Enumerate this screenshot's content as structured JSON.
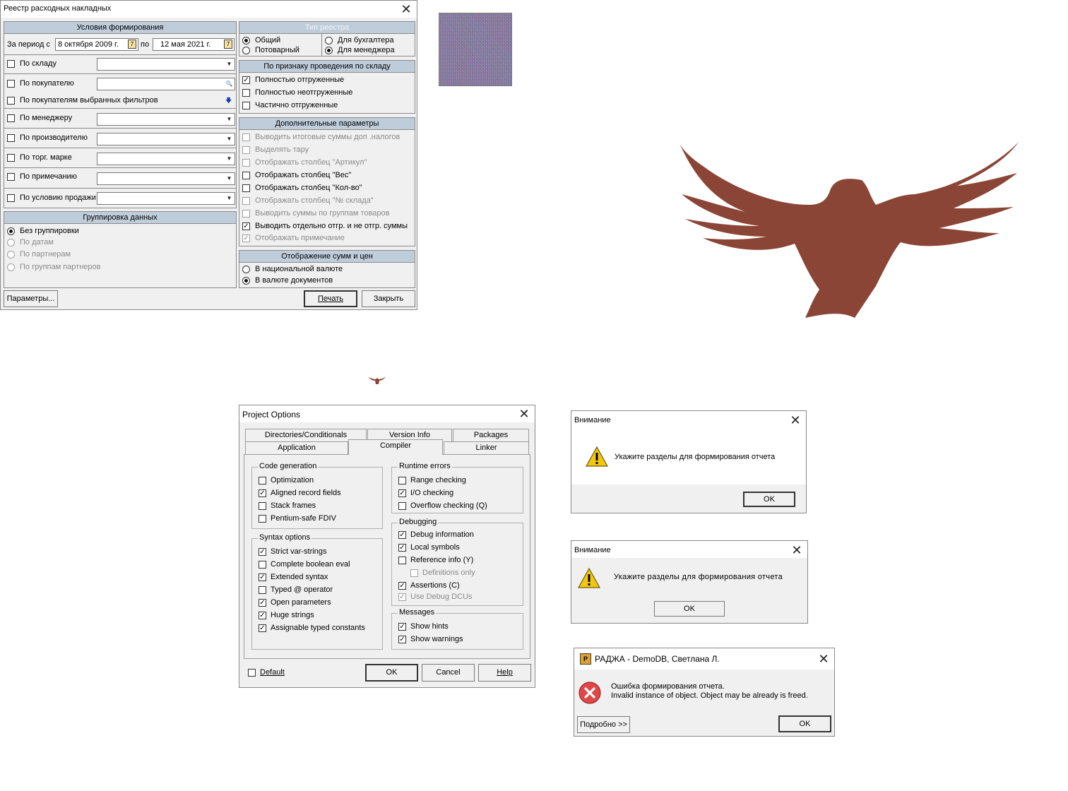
{
  "reestr": {
    "title": "Реестр расходных накладных",
    "conditions": {
      "header": "Условия формирования",
      "period_from_label": "За период с",
      "date_from": "8 октября 2009 г.",
      "to_label": "по",
      "date_to": "12 мая 2021 г.",
      "filters": [
        {
          "label": "По складу",
          "checked": false
        },
        {
          "label": "По покупателю",
          "checked": false
        },
        {
          "label": "По покупателям выбранных фильтров",
          "checked": false
        },
        {
          "label": "По менеджеру",
          "checked": false
        },
        {
          "label": "По производителю",
          "checked": false
        },
        {
          "label": "По торг. марке",
          "checked": false
        },
        {
          "label": "По примечанию",
          "checked": false
        },
        {
          "label": "По условию продажи",
          "checked": false
        }
      ]
    },
    "grouping": {
      "header": "Группировка данных",
      "options": [
        {
          "label": "Без группировки",
          "selected": true,
          "enabled": true
        },
        {
          "label": "По датам",
          "selected": false,
          "enabled": false
        },
        {
          "label": "По партнерам",
          "selected": false,
          "enabled": false
        },
        {
          "label": "По группам партнеров",
          "selected": false,
          "enabled": false
        }
      ]
    },
    "register_type": {
      "header": "Тип реестра",
      "options": [
        {
          "label": "Общий",
          "selected": true
        },
        {
          "label": "Потоварный",
          "selected": false
        },
        {
          "label": "Для бухгалтера",
          "selected": false
        },
        {
          "label": "Для менеджера",
          "selected": true
        }
      ]
    },
    "warehouse": {
      "header": "По признаку проведения по складу",
      "options": [
        {
          "label": "Полностью отгруженные",
          "checked": true
        },
        {
          "label": "Полностью неотгруженные",
          "checked": false
        },
        {
          "label": "Частично отгруженные",
          "checked": false
        }
      ]
    },
    "extra": {
      "header": "Дополнительные параметры",
      "options": [
        {
          "label": "Выводить итоговые суммы доп .налогов",
          "checked": false,
          "enabled": false
        },
        {
          "label": "Выделять тару",
          "checked": false,
          "enabled": false
        },
        {
          "label": "Отображать столбец \"Артикул\"",
          "checked": false,
          "enabled": false
        },
        {
          "label": "Отображать столбец \"Вес\"",
          "checked": false,
          "enabled": true
        },
        {
          "label": "Отображать столбец \"Кол-во\"",
          "checked": false,
          "enabled": true
        },
        {
          "label": "Отображать столбец \"№ склада\"",
          "checked": false,
          "enabled": false
        },
        {
          "label": "Выводить суммы по группам товаров",
          "checked": false,
          "enabled": false
        },
        {
          "label": "Выводить отдельно отгр. и не отгр. суммы",
          "checked": true,
          "enabled": true
        },
        {
          "label": "Отображать примечание",
          "checked": true,
          "enabled": false
        }
      ]
    },
    "sums": {
      "header": "Отображение сумм и цен",
      "options": [
        {
          "label": "В национальной валюте",
          "selected": false
        },
        {
          "label": "В валюте документов",
          "selected": true
        }
      ]
    },
    "buttons": {
      "params": "Параметры...",
      "print": "Печать",
      "close": "Закрыть"
    }
  },
  "project_options": {
    "title": "Project Options",
    "tabs_back": [
      "Directories/Conditionals",
      "Version Info",
      "Packages"
    ],
    "tabs_front": [
      "Application",
      "Compiler",
      "Linker"
    ],
    "active_tab": "Compiler",
    "code_generation": {
      "legend": "Code generation",
      "items": [
        {
          "label": "Optimization",
          "checked": false,
          "enabled": true
        },
        {
          "label": "Aligned record fields",
          "checked": true,
          "enabled": true
        },
        {
          "label": "Stack frames",
          "checked": false,
          "enabled": true
        },
        {
          "label": "Pentium-safe FDIV",
          "checked": false,
          "enabled": true
        }
      ]
    },
    "syntax_options": {
      "legend": "Syntax options",
      "items": [
        {
          "label": "Strict var-strings",
          "checked": true,
          "enabled": true
        },
        {
          "label": "Complete boolean eval",
          "checked": false,
          "enabled": true
        },
        {
          "label": "Extended syntax",
          "checked": true,
          "enabled": true
        },
        {
          "label": "Typed @ operator",
          "checked": false,
          "enabled": true
        },
        {
          "label": "Open parameters",
          "checked": true,
          "enabled": true
        },
        {
          "label": "Huge strings",
          "checked": true,
          "enabled": true
        },
        {
          "label": "Assignable typed constants",
          "checked": true,
          "enabled": true
        }
      ]
    },
    "runtime_errors": {
      "legend": "Runtime errors",
      "items": [
        {
          "label": "Range checking",
          "checked": false,
          "enabled": true
        },
        {
          "label": "I/O checking",
          "checked": true,
          "enabled": true
        },
        {
          "label": "Overflow checking (Q)",
          "checked": false,
          "enabled": true
        }
      ]
    },
    "debugging": {
      "legend": "Debugging",
      "items": [
        {
          "label": "Debug information",
          "checked": true,
          "enabled": true
        },
        {
          "label": "Local symbols",
          "checked": true,
          "enabled": true
        },
        {
          "label": "Reference info (Y)",
          "checked": false,
          "enabled": true
        },
        {
          "label": "Definitions only",
          "checked": false,
          "enabled": false
        },
        {
          "label": "Assertions (C)",
          "checked": true,
          "enabled": true
        },
        {
          "label": "Use Debug DCUs",
          "checked": true,
          "enabled": false
        }
      ]
    },
    "messages": {
      "legend": "Messages",
      "items": [
        {
          "label": "Show hints",
          "checked": true,
          "enabled": true
        },
        {
          "label": "Show warnings",
          "checked": true,
          "enabled": true
        }
      ]
    },
    "default_label": "Default",
    "buttons": {
      "ok": "OK",
      "cancel": "Cancel",
      "help": "Help"
    }
  },
  "alert1": {
    "title": "Внимание",
    "message": "Укажите разделы для формирования отчета",
    "ok": "OK"
  },
  "alert2": {
    "title": "Внимание",
    "message": "Укажите разделы для формирования отчета",
    "ok": "OK"
  },
  "error_dialog": {
    "title": "РАДЖА - DemoDB, Светлана Л.",
    "line1": "Ошибка формирования отчета.",
    "line2": "Invalid instance of object. Object may be already is freed.",
    "details": "Подробно >>",
    "ok": "OK"
  },
  "colors": {
    "bird": "#8b4536",
    "group_header": "#bfcddb"
  }
}
